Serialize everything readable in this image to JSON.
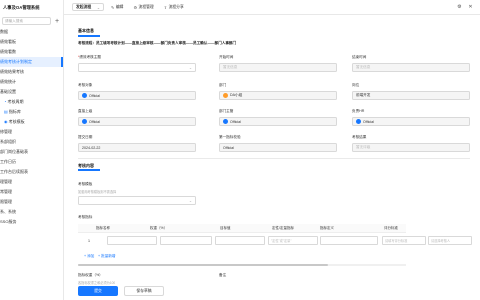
{
  "app": {
    "title": "人事及OA管理系统"
  },
  "sidebar": {
    "search_placeholder": "请输入搜索",
    "items": [
      {
        "label": "数据"
      },
      {
        "label": "绩效看板"
      },
      {
        "label": "绩效看数"
      },
      {
        "label": "绩效考核计划制定"
      },
      {
        "label": "绩效结果考核"
      },
      {
        "label": "绩效统计"
      },
      {
        "label": "基础设置"
      },
      {
        "label": "考核周期"
      },
      {
        "label": "指标库"
      },
      {
        "label": "考核模板"
      },
      {
        "label": "修管理"
      },
      {
        "label": "系部组织"
      },
      {
        "label": "部门岗位基础表"
      },
      {
        "label": "工作日历"
      },
      {
        "label": "工作台后续报表"
      },
      {
        "label": "理管理"
      },
      {
        "label": "常管理"
      },
      {
        "label": "限管理"
      },
      {
        "label": "系、系统"
      },
      {
        "label": "SSO服务"
      }
    ]
  },
  "topbar": {
    "mode": "发起流程",
    "items": [
      "编辑",
      "流程管理",
      "流程分享"
    ]
  },
  "basic": {
    "title": "基本信息",
    "flow": "考核流程：员工填写考核计划——直接上级审核——部门负责人审核——员工确认——部门人事部门",
    "fields": {
      "theme_label": "绩效考核主题",
      "start_label": "开始时间",
      "end_label": "结束时间",
      "start_placeholder": "暂无信息",
      "end_placeholder": "暂无信息",
      "target_label": "考核对象",
      "target_value": "Official",
      "dept_label": "部门",
      "dept_value": "DA小组",
      "post_label": "岗位",
      "post_value": "前端开发",
      "leader_label": "直接上级",
      "leader_value": "Official",
      "manager_label": "部门主管",
      "manager_value": "Official",
      "hr_label": "负责HR",
      "hr_value": "Official",
      "submit_label": "提交日期",
      "submit_value": "2024-02-22",
      "check_label": "第一指标校验",
      "check_value": "Official",
      "result_label": "考核结果",
      "result_value": "暂无评级"
    }
  },
  "content": {
    "title": "考核内容",
    "template_label": "考核模板",
    "template_hint": "如套用考核模板则不需选择",
    "indicator_label": "考核指标",
    "columns": [
      "指标名称",
      "权重（%）",
      "目标值",
      "定性/定量指标",
      "指标定义",
      "评分标准"
    ],
    "row": {
      "num": "1",
      "placeholders": [
        "",
        "",
        "",
        "\"定性\"或\"定量\"",
        "",
        "请填写评分标准",
        "请选择考核人",
        "请选择评分人"
      ]
    },
    "op_add": "+ 添加",
    "op_batch": "+ 批量新增",
    "weight_label": "指标权重（%）",
    "weight_hint": "各指标权重之和必须为100",
    "remark_label": "备注"
  },
  "actions": {
    "submit": "提交",
    "save": "保存草稿"
  },
  "colors": {
    "accent": "#1677ff"
  }
}
